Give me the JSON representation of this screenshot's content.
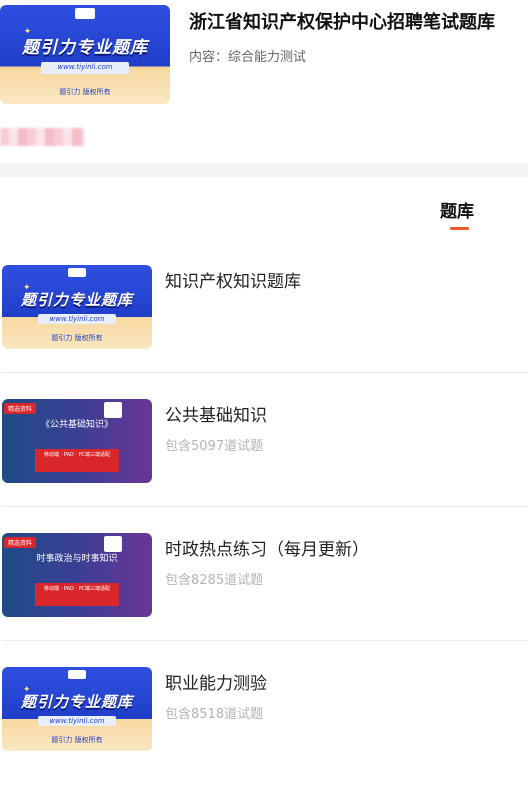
{
  "header": {
    "title": "浙江省知识产权保护中心招聘笔试题库",
    "subtitle": "内容：综合能力测试",
    "thumb": {
      "brand": "题引力专业题库",
      "url": "www.tiyinli.com",
      "copyright": "题引力 版权所有"
    }
  },
  "tabs": {
    "active": "题库"
  },
  "items": [
    {
      "name": "知识产权知识题库",
      "count": "",
      "thumb": {
        "style": "blue",
        "brand": "题引力专业题库",
        "url": "www.tiyinli.com",
        "copyright": "题引力 版权所有"
      }
    },
    {
      "name": "公共基础知识",
      "count": "包含5097道试题",
      "thumb": {
        "style": "purple",
        "tag": "精选资料",
        "title": "《公共基础知识》",
        "box": "移动端 · PAD · PC端三端适配"
      }
    },
    {
      "name": "时政热点练习（每月更新）",
      "count": "包含8285道试题",
      "thumb": {
        "style": "purple",
        "tag": "精选资料",
        "title": "时事政治与时事知识",
        "box": "移动端 · PAD · PC端三端适配"
      }
    },
    {
      "name": "职业能力测验",
      "count": "包含8518道试题",
      "thumb": {
        "style": "blue",
        "brand": "题引力专业题库",
        "url": "www.tiyinli.com",
        "copyright": "题引力 版权所有"
      }
    }
  ]
}
